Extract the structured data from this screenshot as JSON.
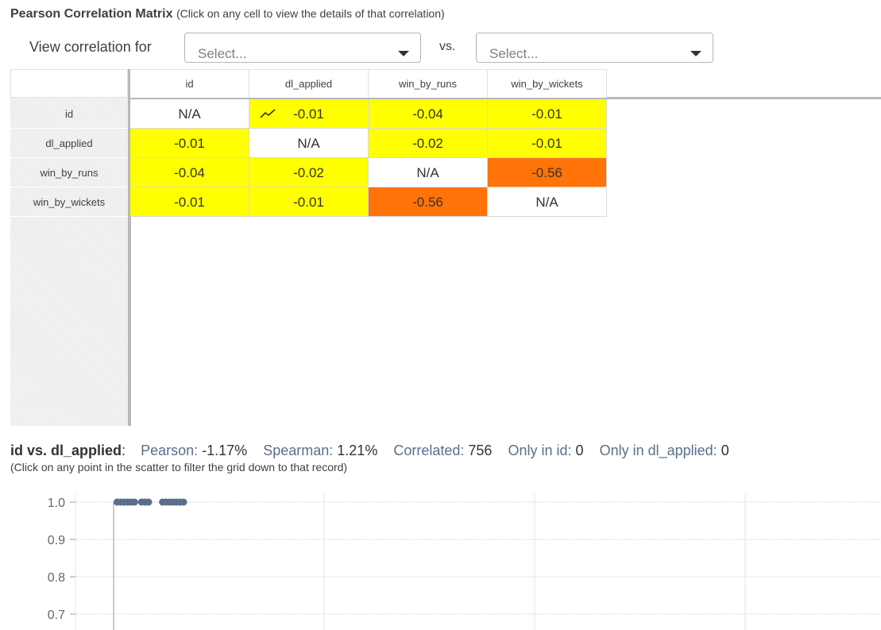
{
  "header": {
    "title": "Pearson Correlation Matrix",
    "hint": "(Click on any cell to view the details of that correlation)"
  },
  "filters": {
    "view_label": "View correlation for",
    "select1_placeholder": "Select...",
    "vs_label": "vs.",
    "select2_placeholder": "Select..."
  },
  "matrix": {
    "columns": [
      "id",
      "dl_applied",
      "win_by_runs",
      "win_by_wickets"
    ],
    "rows": [
      {
        "name": "id",
        "cells": [
          "N/A",
          "-0.01",
          "-0.04",
          "-0.01"
        ]
      },
      {
        "name": "dl_applied",
        "cells": [
          "-0.01",
          "N/A",
          "-0.02",
          "-0.01"
        ]
      },
      {
        "name": "win_by_runs",
        "cells": [
          "-0.04",
          "-0.02",
          "N/A",
          "-0.56"
        ]
      },
      {
        "name": "win_by_wickets",
        "cells": [
          "-0.01",
          "-0.01",
          "-0.56",
          "N/A"
        ]
      }
    ],
    "colors": {
      "weak": "#ffff00",
      "moderate": "#ff7308",
      "na": "#ffffff"
    }
  },
  "details": {
    "pair": "id vs. dl_applied",
    "colon": ":",
    "pearson_label": "Pearson:",
    "pearson_value": "-1.17%",
    "spearman_label": "Spearman:",
    "spearman_value": "1.21%",
    "correlated_label": "Correlated:",
    "correlated_value": "756",
    "only_x_label": "Only in id:",
    "only_x_value": "0",
    "only_y_label": "Only in dl_applied:",
    "only_y_value": "0",
    "hint": "(Click on any point in the scatter to filter the grid down to that record)"
  },
  "chart_data": {
    "type": "scatter",
    "title": "",
    "xlabel": "",
    "ylabel": "",
    "ylim": [
      0.65,
      1.0
    ],
    "y_ticks": [
      "1.0",
      "0.9",
      "0.8",
      "0.7"
    ],
    "grid": true,
    "point_color": "#5b6e8c",
    "series": [
      {
        "x": [
          1,
          2,
          3,
          4,
          5,
          6,
          8,
          9,
          10,
          14,
          15,
          16,
          17,
          18,
          19,
          20
        ],
        "y": [
          1.0,
          1.0,
          1.0,
          1.0,
          1.0,
          1.0,
          1.0,
          1.0,
          1.0,
          1.0,
          1.0,
          1.0,
          1.0,
          1.0,
          1.0,
          1.0
        ]
      }
    ]
  }
}
